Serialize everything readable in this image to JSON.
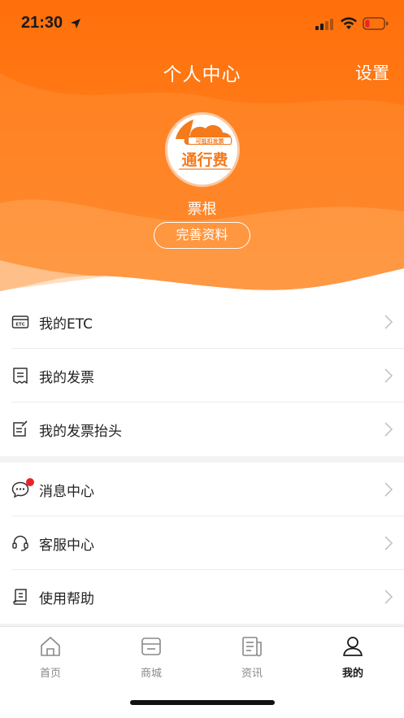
{
  "status_bar": {
    "time": "21:30"
  },
  "nav": {
    "title": "个人中心",
    "settings": "设置"
  },
  "profile": {
    "name": "票根",
    "edit_button": "完善资料",
    "logo_top": "可抵扣发票",
    "logo_main": "通行费"
  },
  "menu_group_1": [
    {
      "label": "我的ETC",
      "icon": "etc-card-icon"
    },
    {
      "label": "我的发票",
      "icon": "invoice-icon"
    },
    {
      "label": "我的发票抬头",
      "icon": "invoice-title-icon"
    }
  ],
  "menu_group_2": [
    {
      "label": "消息中心",
      "icon": "message-icon"
    },
    {
      "label": "客服中心",
      "icon": "headset-icon"
    },
    {
      "label": "使用帮助",
      "icon": "help-book-icon"
    }
  ],
  "tabbar": {
    "tabs": [
      {
        "label": "首页",
        "icon": "home-icon"
      },
      {
        "label": "商城",
        "icon": "shop-icon"
      },
      {
        "label": "资讯",
        "icon": "news-icon"
      },
      {
        "label": "我的",
        "icon": "user-icon"
      }
    ],
    "active": "我的"
  },
  "colors": {
    "header_orange": "#ff7a12",
    "header_orange_light": "#ffa451",
    "unread_dot": "#e8242a"
  }
}
